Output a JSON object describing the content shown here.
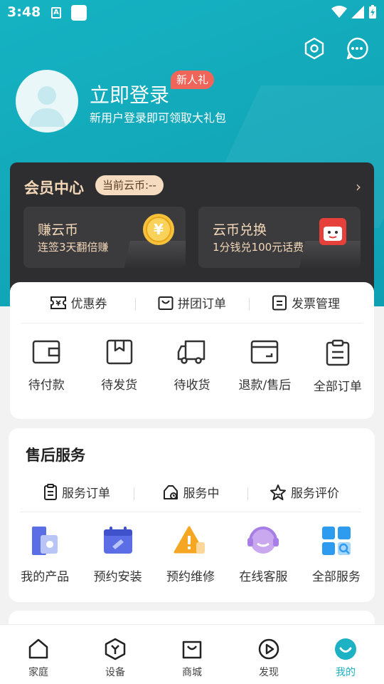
{
  "status_bar": {
    "time": "3:48"
  },
  "login": {
    "title": "立即登录",
    "badge": "新人礼",
    "subtitle": "新用户登录即可领取大礼包"
  },
  "member": {
    "title": "会员中心",
    "coins": "当前云币:--",
    "cards": [
      {
        "title": "赚云币",
        "subtitle": "连签3天翻倍赚",
        "icon": "yuan-coin-icon"
      },
      {
        "title": "云币兑换",
        "subtitle": "1分钱兑100元话费",
        "icon": "jd-box-icon"
      }
    ]
  },
  "orders": {
    "tabs": [
      {
        "label": "优惠券",
        "icon": "coupon-icon"
      },
      {
        "label": "拼团订单",
        "icon": "bag-icon"
      },
      {
        "label": "发票管理",
        "icon": "invoice-icon"
      }
    ],
    "items": [
      {
        "label": "待付款",
        "icon": "wallet-icon"
      },
      {
        "label": "待发货",
        "icon": "package-icon"
      },
      {
        "label": "待收货",
        "icon": "truck-icon"
      },
      {
        "label": "退款/售后",
        "icon": "refund-icon"
      },
      {
        "label": "全部订单",
        "icon": "clipboard-icon"
      }
    ]
  },
  "after_sales": {
    "title": "售后服务",
    "tabs": [
      {
        "label": "服务订单",
        "icon": "order-list-icon"
      },
      {
        "label": "服务中",
        "icon": "service-progress-icon"
      },
      {
        "label": "服务评价",
        "icon": "star-icon"
      }
    ],
    "items": [
      {
        "label": "我的产品",
        "icon": "product-icon"
      },
      {
        "label": "预约安装",
        "icon": "install-calendar-icon"
      },
      {
        "label": "预约维修",
        "icon": "repair-warning-icon"
      },
      {
        "label": "在线客服",
        "icon": "support-headset-icon"
      },
      {
        "label": "全部服务",
        "icon": "all-services-icon"
      }
    ]
  },
  "bottom_nav": [
    {
      "label": "家庭",
      "icon": "home-icon"
    },
    {
      "label": "设备",
      "icon": "device-icon"
    },
    {
      "label": "商城",
      "icon": "mall-bag-icon"
    },
    {
      "label": "发现",
      "icon": "discover-play-icon"
    },
    {
      "label": "我的",
      "icon": "profile-smile-icon",
      "active": true
    }
  ],
  "colors": {
    "accent": "#1db1c4",
    "hero_bg": "#13acbe",
    "member_bg": "#2e2e30",
    "gold_text": "#f3d7b8",
    "badge": "#f0655a"
  }
}
